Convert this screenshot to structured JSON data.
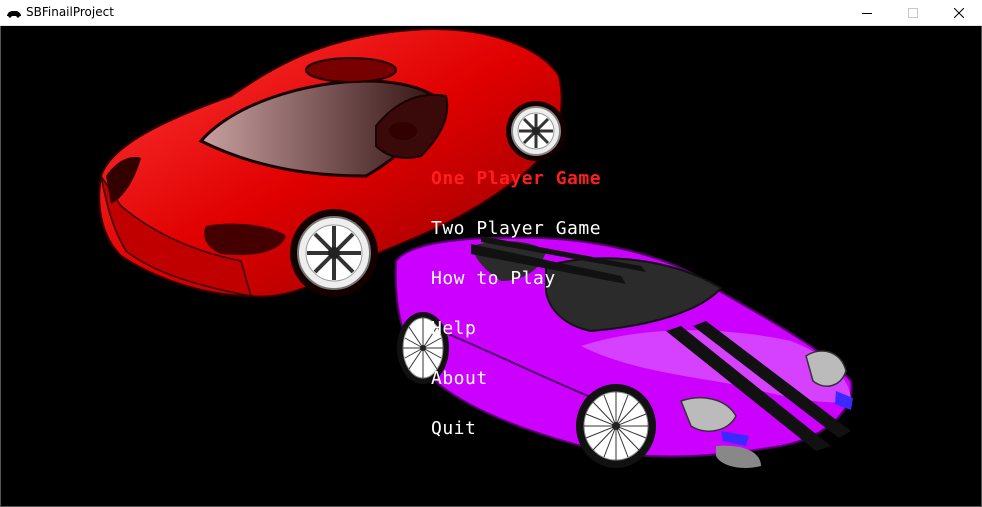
{
  "window": {
    "title": "SBFinailProject",
    "icon": "car-icon"
  },
  "menu": {
    "items": [
      {
        "label": "One Player Game",
        "selected": true
      },
      {
        "label": "Two Player Game",
        "selected": false
      },
      {
        "label": "How to Play",
        "selected": false
      },
      {
        "label": "Help",
        "selected": false
      },
      {
        "label": "About",
        "selected": false
      },
      {
        "label": "Quit",
        "selected": false
      }
    ]
  },
  "colors": {
    "background": "#000000",
    "menu_text": "#ffffff",
    "selected_text": "#ff1e1e",
    "red_car": "#e00000",
    "purple_car": "#cc00ff"
  },
  "artwork": {
    "red_car": "red sports car",
    "purple_car": "purple sports car with black racing stripes"
  }
}
